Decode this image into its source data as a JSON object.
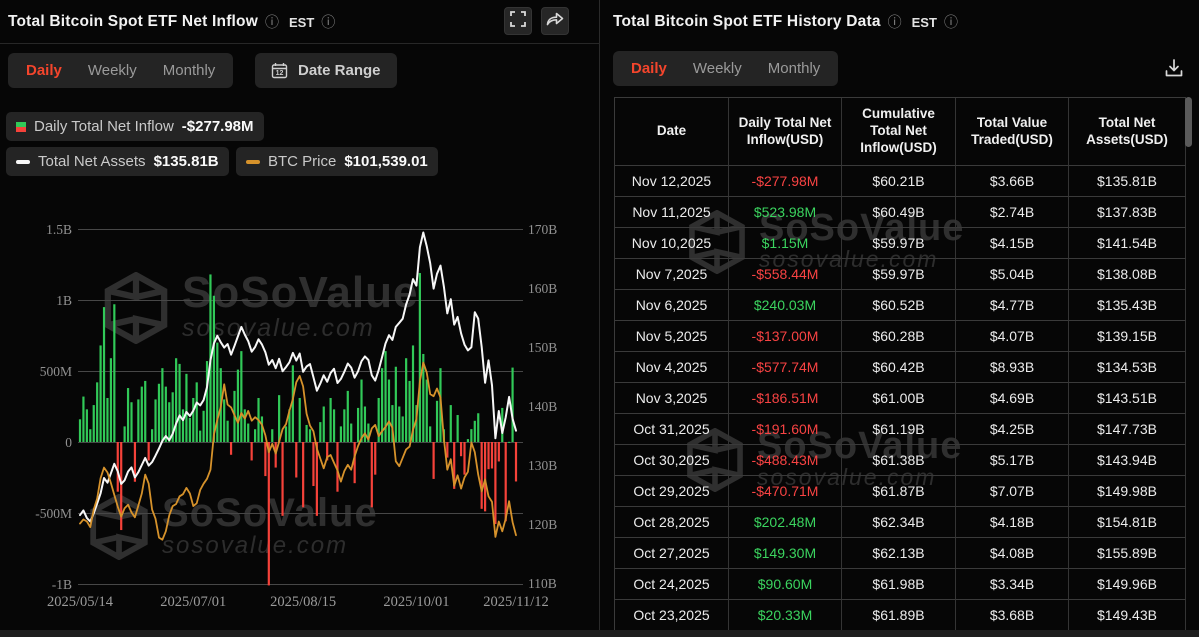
{
  "left_panel": {
    "title": "Total Bitcoin Spot ETF Net Inflow",
    "est_label": "EST",
    "tabs": {
      "items": [
        "Daily",
        "Weekly",
        "Monthly"
      ],
      "active": "Daily"
    },
    "date_range_label": "Date Range",
    "legend": [
      {
        "label": "Daily Total Net Inflow",
        "value": "-$277.98M",
        "swatch": "bar"
      },
      {
        "label": "Total Net Assets",
        "value": "$135.81B",
        "swatch": "white-dash"
      },
      {
        "label": "BTC Price",
        "value": "$101,539.01",
        "swatch": "gold-dash"
      }
    ]
  },
  "right_panel": {
    "title": "Total Bitcoin Spot ETF History Data",
    "est_label": "EST",
    "tabs": {
      "items": [
        "Daily",
        "Weekly",
        "Monthly"
      ],
      "active": "Daily"
    },
    "table": {
      "columns": [
        "Date",
        "Daily Total Net Inflow(USD)",
        "Cumulative Total Net Inflow(USD)",
        "Total Value Traded(USD)",
        "Total Net Assets(USD)"
      ],
      "rows": [
        [
          "Nov 12,2025",
          "-$277.98M",
          "$60.21B",
          "$3.66B",
          "$135.81B"
        ],
        [
          "Nov 11,2025",
          "$523.98M",
          "$60.49B",
          "$2.74B",
          "$137.83B"
        ],
        [
          "Nov 10,2025",
          "$1.15M",
          "$59.97B",
          "$4.15B",
          "$141.54B"
        ],
        [
          "Nov 7,2025",
          "-$558.44M",
          "$59.97B",
          "$5.04B",
          "$138.08B"
        ],
        [
          "Nov 6,2025",
          "$240.03M",
          "$60.52B",
          "$4.77B",
          "$135.43B"
        ],
        [
          "Nov 5,2025",
          "-$137.00M",
          "$60.28B",
          "$4.07B",
          "$139.15B"
        ],
        [
          "Nov 4,2025",
          "-$577.74M",
          "$60.42B",
          "$8.93B",
          "$134.53B"
        ],
        [
          "Nov 3,2025",
          "-$186.51M",
          "$61.00B",
          "$4.69B",
          "$143.51B"
        ],
        [
          "Oct 31,2025",
          "-$191.60M",
          "$61.19B",
          "$4.25B",
          "$147.73B"
        ],
        [
          "Oct 30,2025",
          "-$488.43M",
          "$61.38B",
          "$5.17B",
          "$143.94B"
        ],
        [
          "Oct 29,2025",
          "-$470.71M",
          "$61.87B",
          "$7.07B",
          "$149.98B"
        ],
        [
          "Oct 28,2025",
          "$202.48M",
          "$62.34B",
          "$4.18B",
          "$154.81B"
        ],
        [
          "Oct 27,2025",
          "$149.30M",
          "$62.13B",
          "$4.08B",
          "$155.89B"
        ],
        [
          "Oct 24,2025",
          "$90.60M",
          "$61.98B",
          "$3.34B",
          "$149.96B"
        ],
        [
          "Oct 23,2025",
          "$20.33M",
          "$61.89B",
          "$3.68B",
          "$149.43B"
        ]
      ]
    }
  },
  "watermark": {
    "brand": "SoSoValue",
    "domain": "sosovalue.com"
  },
  "icons": {
    "info": "ⓘ"
  },
  "colors": {
    "accent_red": "#f4452c",
    "bar_green": "#31c958",
    "bar_red": "#f5423a",
    "assets_line": "#f7f7f7",
    "btc_line": "#d6922b",
    "table_green": "#3bd45f",
    "table_red": "#f84343"
  },
  "chart_data": {
    "type": "combo",
    "title": "Total Bitcoin Spot ETF Net Inflow",
    "x_ticks": [
      "2025/05/14",
      "2025/07/01",
      "2025/08/15",
      "2025/10/01",
      "2025/11/12"
    ],
    "x_tick_indices": [
      0,
      33,
      65,
      98,
      127
    ],
    "left_axis": {
      "unit": "USD",
      "ticks": [
        "1.5B",
        "1B",
        "500M",
        "0",
        "-500M",
        "-1B"
      ],
      "values": [
        1500,
        1000,
        500,
        0,
        -500,
        -1000
      ]
    },
    "right_axis": {
      "unit": "USD",
      "ticks": [
        "170B",
        "160B",
        "150B",
        "140B",
        "130B",
        "120B",
        "110B"
      ],
      "values": [
        170,
        160,
        150,
        140,
        130,
        120,
        110
      ]
    },
    "series": [
      {
        "name": "Daily Total Net Inflow",
        "type": "bar",
        "axis": "left",
        "unit": "USD millions",
        "current": "-$277.98M",
        "values": [
          160,
          320,
          230,
          90,
          260,
          420,
          680,
          950,
          310,
          590,
          970,
          -350,
          -620,
          110,
          380,
          280,
          -280,
          300,
          390,
          430,
          -130,
          90,
          300,
          410,
          520,
          390,
          280,
          350,
          590,
          550,
          230,
          480,
          170,
          310,
          420,
          80,
          220,
          570,
          1180,
          1030,
          700,
          520,
          300,
          150,
          -90,
          360,
          510,
          640,
          230,
          130,
          -130,
          90,
          310,
          180,
          -240,
          -1010,
          90,
          -180,
          330,
          -520,
          110,
          230,
          540,
          -250,
          310,
          -460,
          120,
          90,
          -310,
          -520,
          140,
          250,
          -130,
          310,
          230,
          -350,
          110,
          230,
          360,
          130,
          -290,
          240,
          440,
          250,
          130,
          -460,
          -230,
          310,
          520,
          640,
          440,
          260,
          530,
          250,
          180,
          590,
          430,
          680,
          260,
          1190,
          620,
          440,
          110,
          -260,
          290,
          520,
          90,
          -110,
          260,
          -330,
          190,
          -100,
          -230,
          20.33,
          90.6,
          149.3,
          202.48,
          -470.71,
          -488.43,
          -191.6,
          -186.51,
          -577.74,
          -137,
          240.03,
          -558.44,
          1.15,
          523.98,
          -277.98
        ]
      },
      {
        "name": "Total Net Assets",
        "type": "line",
        "axis": "right",
        "unit": "USD billions",
        "current": "$135.81B",
        "values": [
          121.5,
          122.3,
          121.0,
          120.4,
          121.8,
          123.5,
          125.2,
          127.8,
          127.0,
          128.6,
          130.2,
          128.9,
          126.8,
          127.4,
          128.9,
          129.6,
          127.9,
          128.8,
          130.0,
          131.2,
          129.9,
          130.5,
          131.6,
          132.8,
          134.1,
          134.9,
          134.2,
          135.3,
          137.0,
          138.4,
          137.6,
          139.0,
          138.3,
          139.2,
          140.6,
          140.1,
          141.0,
          143.2,
          147.8,
          150.6,
          151.9,
          150.8,
          149.9,
          150.5,
          148.7,
          150.2,
          151.8,
          153.4,
          152.1,
          151.0,
          149.2,
          150.0,
          151.3,
          150.4,
          149.1,
          147.0,
          147.8,
          146.4,
          148.0,
          145.9,
          146.6,
          147.4,
          149.0,
          147.7,
          148.9,
          145.8,
          146.7,
          147.1,
          144.9,
          142.6,
          143.8,
          145.2,
          144.1,
          145.6,
          146.3,
          143.9,
          144.6,
          145.8,
          147.2,
          146.5,
          144.8,
          145.9,
          147.6,
          148.4,
          147.8,
          145.2,
          144.3,
          146.1,
          148.3,
          150.6,
          152.0,
          151.2,
          153.4,
          154.1,
          154.8,
          157.2,
          158.9,
          161.5,
          160.4,
          166.9,
          169.4,
          167.1,
          164.2,
          159.9,
          162.4,
          163.8,
          160.2,
          155.7,
          158.1,
          153.8,
          155.1,
          152.3,
          150.4,
          149.43,
          149.96,
          155.89,
          154.81,
          149.98,
          143.94,
          147.73,
          143.51,
          134.53,
          139.15,
          135.43,
          138.08,
          141.54,
          137.83,
          135.81
        ]
      },
      {
        "name": "BTC Price",
        "type": "line",
        "axis": "hidden",
        "unit": "USD thousands",
        "current": "$101,539.01",
        "values": [
          103.2,
          103.8,
          103.5,
          102.7,
          105.2,
          106.8,
          109.7,
          111.2,
          110.5,
          109.0,
          107.3,
          105.6,
          104.2,
          105.4,
          105.9,
          104.8,
          104.1,
          105.8,
          107.5,
          110.2,
          108.9,
          105.2,
          103.9,
          101.2,
          100.9,
          102.1,
          104.4,
          105.7,
          106.0,
          107.1,
          107.4,
          108.3,
          107.5,
          105.7,
          106.1,
          108.0,
          108.9,
          109.6,
          110.9,
          115.9,
          118.0,
          119.9,
          123.1,
          120.2,
          119.8,
          118.7,
          117.6,
          119.0,
          118.2,
          119.3,
          117.9,
          118.4,
          118.0,
          117.3,
          115.8,
          113.4,
          114.6,
          113.2,
          114.9,
          116.7,
          117.4,
          119.3,
          121.0,
          123.4,
          124.3,
          122.8,
          118.9,
          117.2,
          116.4,
          113.9,
          112.5,
          111.1,
          112.7,
          113.0,
          111.9,
          110.8,
          109.2,
          110.7,
          111.6,
          110.9,
          112.8,
          114.3,
          115.4,
          116.1,
          115.2,
          116.8,
          117.3,
          115.7,
          116.4,
          117.0,
          117.8,
          116.9,
          112.1,
          111.4,
          112.6,
          113.8,
          114.2,
          116.6,
          118.1,
          123.5,
          126.2,
          124.8,
          121.7,
          121.4,
          122.5,
          121.2,
          115.3,
          110.9,
          112.4,
          108.6,
          110.1,
          108.2,
          109.8,
          110.6,
          114.8,
          113.4,
          110.2,
          107.8,
          109.5,
          107.1,
          106.3,
          101.3,
          103.5,
          102.1,
          103.9,
          106.4,
          103.4,
          101.539
        ]
      }
    ]
  }
}
